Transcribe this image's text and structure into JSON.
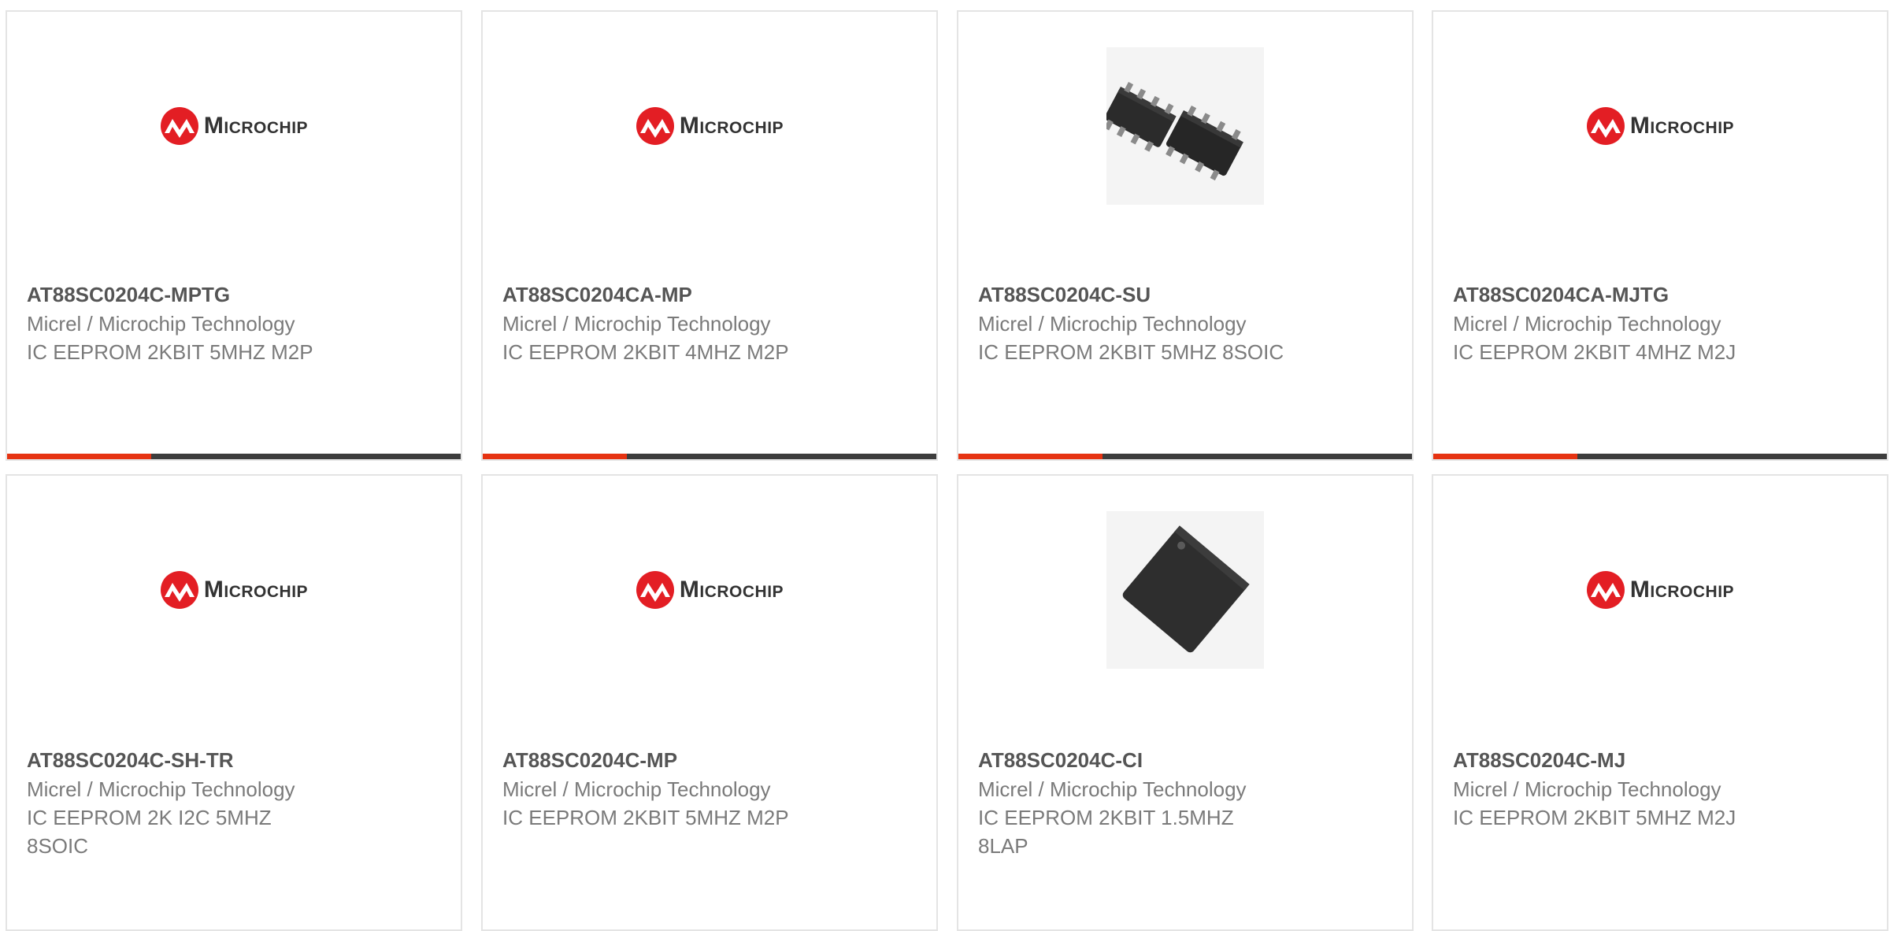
{
  "colors": {
    "accent": "#e63312",
    "bar_dark": "#3d3d3d",
    "logo_red": "#e31e24"
  },
  "products": [
    {
      "part_number": "AT88SC0204C-MPTG",
      "manufacturer": "Micrel / Microchip Technology",
      "description": "IC EEPROM 2KBIT 5MHZ M2P",
      "image": "microchip-logo",
      "logo_text": "Microchip"
    },
    {
      "part_number": "AT88SC0204CA-MP",
      "manufacturer": "Micrel / Microchip Technology",
      "description": "IC EEPROM 2KBIT 4MHZ M2P",
      "image": "microchip-logo",
      "logo_text": "Microchip"
    },
    {
      "part_number": "AT88SC0204C-SU",
      "manufacturer": "Micrel / Microchip Technology",
      "description": "IC EEPROM 2KBIT 5MHZ 8SOIC",
      "image": "soic-chip-photo"
    },
    {
      "part_number": "AT88SC0204CA-MJTG",
      "manufacturer": "Micrel / Microchip Technology",
      "description": "IC EEPROM 2KBIT 4MHZ M2J",
      "image": "microchip-logo",
      "logo_text": "Microchip"
    },
    {
      "part_number": "AT88SC0204C-SH-TR",
      "manufacturer": "Micrel / Microchip Technology",
      "description": "IC EEPROM 2K I2C 5MHZ 8SOIC",
      "image": "microchip-logo",
      "logo_text": "Microchip"
    },
    {
      "part_number": "AT88SC0204C-MP",
      "manufacturer": "Micrel / Microchip Technology",
      "description": "IC EEPROM 2KBIT 5MHZ M2P",
      "image": "microchip-logo",
      "logo_text": "Microchip"
    },
    {
      "part_number": "AT88SC0204C-CI",
      "manufacturer": "Micrel / Microchip Technology",
      "description": "IC EEPROM 2KBIT 1.5MHZ 8LAP",
      "image": "lga-chip-photo"
    },
    {
      "part_number": "AT88SC0204C-MJ",
      "manufacturer": "Micrel / Microchip Technology",
      "description": "IC EEPROM 2KBIT 5MHZ M2J",
      "image": "microchip-logo",
      "logo_text": "Microchip"
    }
  ]
}
